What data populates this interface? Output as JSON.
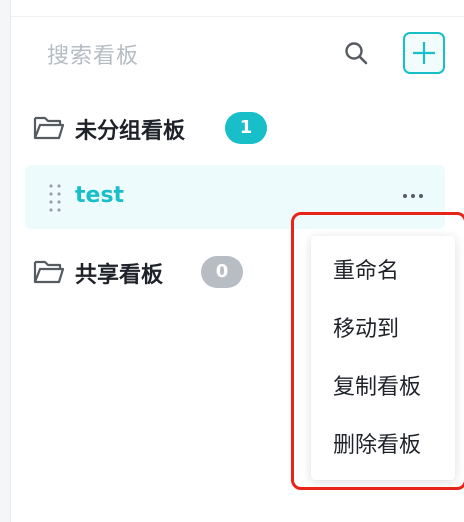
{
  "search": {
    "placeholder": "搜索看板"
  },
  "groups": [
    {
      "name": "未分组看板",
      "count": "1"
    },
    {
      "name": "共享看板",
      "count": "0"
    }
  ],
  "boards": [
    {
      "name": "test",
      "more": "···"
    }
  ],
  "context_menu": {
    "items": [
      "重命名",
      "移动到",
      "复制看板",
      "删除看板"
    ]
  },
  "colors": {
    "accent": "#18bfc9",
    "highlight_border": "#e8231a",
    "badge_inactive": "#b8bdc3"
  },
  "icons": [
    "search-icon",
    "plus-icon",
    "folder-icon",
    "drag-handle-icon",
    "more-icon"
  ]
}
